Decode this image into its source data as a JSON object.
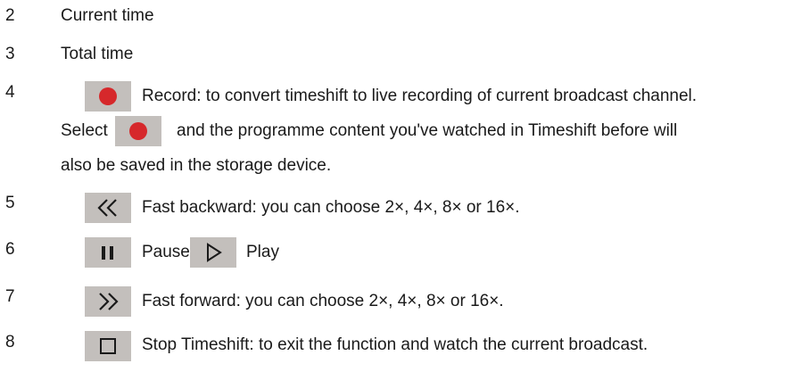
{
  "items": [
    {
      "number": "2",
      "text": "Current time"
    },
    {
      "number": "3",
      "text": "Total time"
    },
    {
      "number": "4",
      "icon": "record-icon",
      "text": "Record: to convert timeshift to live recording of current broadcast channel.",
      "line2_before": "Select",
      "line2_after": "and the programme content you've watched in Timeshift before will",
      "line3": "also be saved in the storage device."
    },
    {
      "number": "5",
      "icon": "fast-backward-icon",
      "text": "Fast backward: you can choose 2×, 4×, 8× or 16×."
    },
    {
      "number": "6",
      "icon": "pause-icon",
      "text_pause": "Pause/",
      "icon2": "play-icon",
      "text_play": "Play"
    },
    {
      "number": "7",
      "icon": "fast-forward-icon",
      "text": "Fast forward: you can choose 2×, 4×, 8× or 16×."
    },
    {
      "number": "8",
      "icon": "stop-icon",
      "text": "Stop Timeshift: to exit the function and watch the current broadcast."
    }
  ],
  "colors": {
    "button_bg": "#c3bfbc",
    "record_red": "#d6282b",
    "text": "#1a1a1a"
  }
}
